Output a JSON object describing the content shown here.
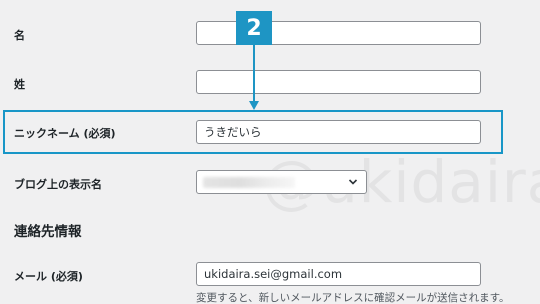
{
  "form": {
    "first_name": {
      "label": "名",
      "value": ""
    },
    "last_name": {
      "label": "姓",
      "value": ""
    },
    "nickname": {
      "label": "ニックネーム (必須)",
      "value": "うきだいら"
    },
    "display_name": {
      "label": "ブログ上の表示名",
      "value": ""
    },
    "contact_heading": "連絡先情報",
    "email": {
      "label": "メール (必須)",
      "value": "ukidaira.sei@gmail.com",
      "hint": "変更すると、新しいメールアドレスに確認メールが送信されます。"
    }
  },
  "annotation": {
    "step_number": "2",
    "color": "#1e95c4"
  },
  "watermark": "@ukidaira"
}
